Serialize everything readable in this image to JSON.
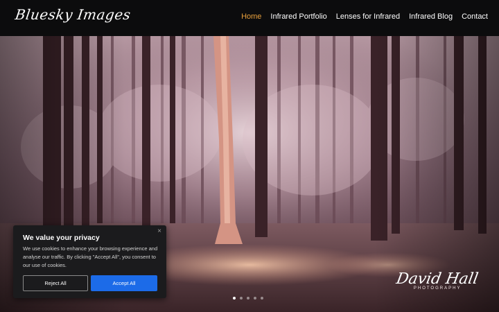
{
  "header": {
    "logo_text": "Bluesky Images",
    "nav": [
      {
        "label": "Home",
        "active": true
      },
      {
        "label": "Infrared Portfolio",
        "active": false
      },
      {
        "label": "Lenses for Infrared",
        "active": false
      },
      {
        "label": "Infrared Blog",
        "active": false
      },
      {
        "label": "Contact",
        "active": false
      }
    ],
    "active_color": "#e8a03c"
  },
  "watermark": {
    "name": "David Hall",
    "sub": "PHOTOGRAPHY"
  },
  "slider": {
    "dots": 5,
    "active_index": 0
  },
  "cookie": {
    "title": "We value your privacy",
    "close": "×",
    "message": "We use cookies to enhance your browsing experience and analyse our traffic. By clicking \"Accept All\", you consent to our use of cookies.",
    "reject_label": "Reject All",
    "accept_label": "Accept All",
    "accept_color": "#1c6be8"
  }
}
